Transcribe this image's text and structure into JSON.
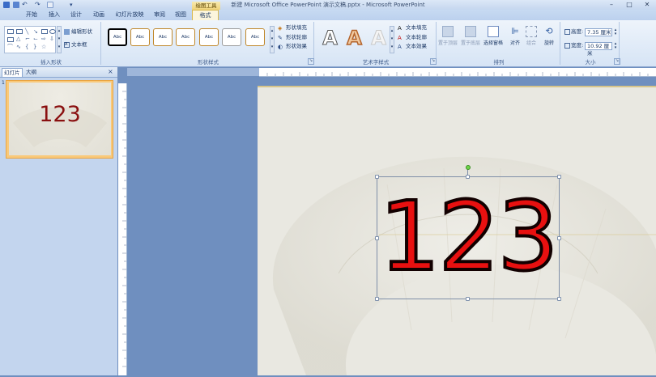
{
  "window": {
    "title": "新建 Microsoft Office PowerPoint 演示文稿.pptx - Microsoft PowerPoint",
    "contextual_tab_group": "绘图工具"
  },
  "tabs": [
    "开始",
    "插入",
    "设计",
    "动画",
    "幻灯片放映",
    "审阅",
    "视图",
    "格式"
  ],
  "active_tab": "格式",
  "ribbon": {
    "insert_shapes": {
      "label": "插入形状",
      "edit_shape": "编辑形状",
      "text_box": "文本框"
    },
    "shape_styles": {
      "label": "形状样式",
      "style_sample": "Abc",
      "style_colors": [
        "#000000",
        "#c0872a",
        "#c0872a",
        "#c0872a",
        "#c0872a",
        "#9a9a9a",
        "#c0872a"
      ],
      "shape_fill": "形状填充",
      "shape_outline": "形状轮廓",
      "shape_effects": "形状效果"
    },
    "wordart_styles": {
      "label": "艺术字样式",
      "sample": "A",
      "text_fill": "文本填充",
      "text_outline": "文本轮廓",
      "text_effects": "文本效果"
    },
    "arrange": {
      "label": "排列",
      "bring_front": "置于顶层",
      "send_back": "置于底层",
      "selection_pane": "选择窗格",
      "align": "对齐",
      "group": "组合",
      "rotate": "旋转"
    },
    "size": {
      "label": "大小",
      "height_label": "高度:",
      "height_value": "7.35 厘米",
      "width_label": "宽度:",
      "width_value": "10.92 厘米"
    }
  },
  "left_pane": {
    "tabs": [
      "幻灯片",
      "大纲"
    ],
    "close": "×",
    "slide_number": "1",
    "thumbnail_text": "123"
  },
  "slide": {
    "text": "123",
    "text_fill": "#e81010",
    "text_outline": "#120000"
  },
  "colors": {
    "ribbon_accent": "#d9b84e",
    "selection_border": "#7f8fa8",
    "rotation_handle": "#6ed44a"
  }
}
